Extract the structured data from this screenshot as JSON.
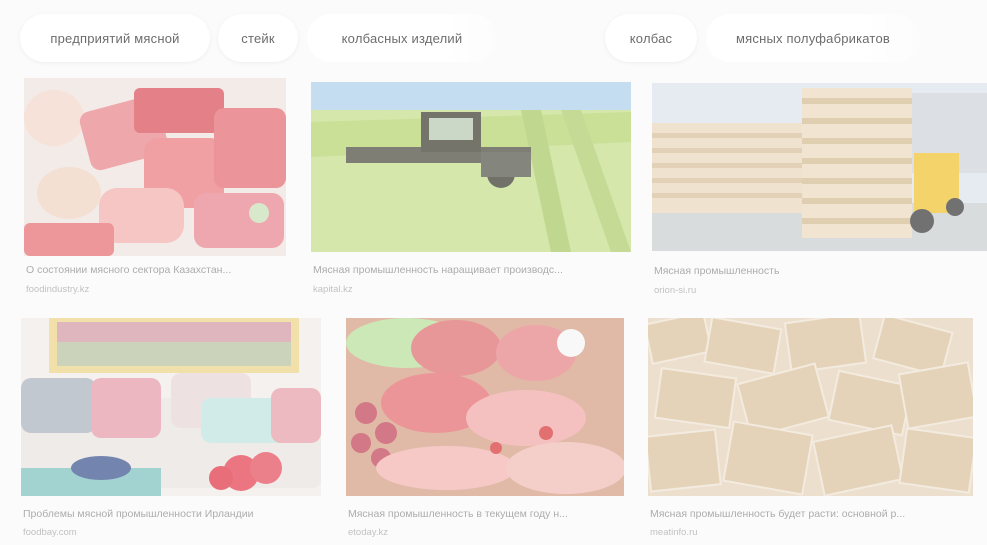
{
  "chips": [
    {
      "label": "предприятий мясной"
    },
    {
      "label": "стейк"
    },
    {
      "label": "колбасных изделий"
    },
    {
      "label": "колбас"
    },
    {
      "label": "мясных полуфабрикатов"
    }
  ],
  "results": [
    {
      "caption": "О состоянии мясного сектора Казахстан...",
      "source": "foodindustry.kz",
      "image": "raw-meat-assortment"
    },
    {
      "caption": "Мясная промышленность наращивает производс...",
      "source": "kapital.kz",
      "image": "harvester-in-field"
    },
    {
      "caption": "Мясная промышленность",
      "source": "orion-si.ru",
      "image": "wooden-pallets-forklift"
    },
    {
      "caption": "Проблемы мясной промышленности Ирландии",
      "source": "foodbay.com",
      "image": "living-room-sofa"
    },
    {
      "caption": "Мясная промышленность в текущем году н...",
      "source": "etoday.kz",
      "image": "meat-platter"
    },
    {
      "caption": "Мясная промышленность будет расти: основной р...",
      "source": "meatinfo.ru",
      "image": "cardboard-boxes"
    }
  ]
}
